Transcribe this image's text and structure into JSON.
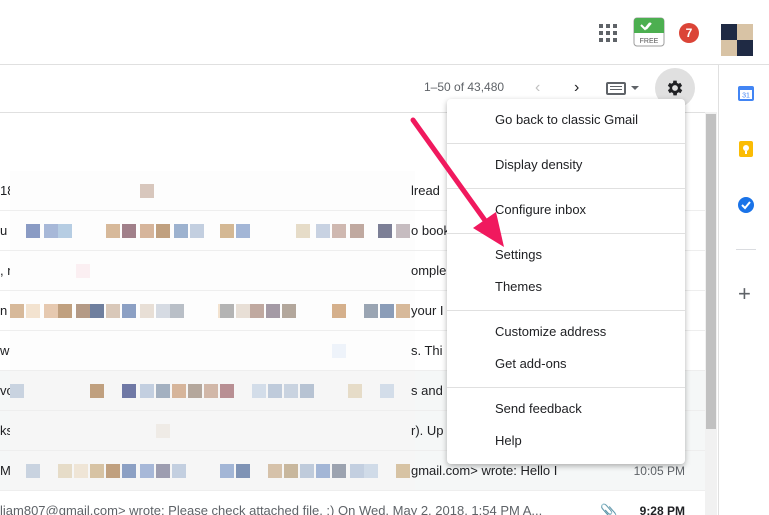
{
  "header": {
    "apps_icon": "apps-grid-icon",
    "free_badge_label": "FREE",
    "notification_count": "7"
  },
  "toolbar": {
    "pagination": "1–50 of 43,480",
    "prev_icon": "‹",
    "next_icon": "›"
  },
  "emails": [
    {
      "pre": "18",
      "mid": "lread"
    },
    {
      "pre": "u",
      "mid": "o book"
    },
    {
      "pre": ", n",
      "mid": "omple"
    },
    {
      "pre": "n a",
      "mid": "your I"
    },
    {
      "pre": "wo",
      "mid": "s. Thi"
    },
    {
      "pre": "vo",
      "mid": "s and"
    },
    {
      "pre": "ks",
      "mid": "r). Up"
    },
    {
      "pre": "Ma",
      "mid": "gmail.com> wrote: Hello I",
      "time": "10:05 PM"
    },
    {
      "pre": "liam807@gmail.com> wrote: Please check attached file. :) On Wed, May 2, 2018, 1:54 PM A...",
      "time": "9:28 PM"
    }
  ],
  "settings_menu": {
    "items": [
      "Go back to classic Gmail",
      "Display density",
      "Configure inbox",
      "Settings",
      "Themes",
      "Customize address",
      "Get add-ons",
      "Send feedback",
      "Help"
    ]
  },
  "side_panel": {
    "calendar_day": "31"
  },
  "colors": {
    "annotation_arrow": "#f0195e",
    "notification_badge": "#db4437",
    "gear_active_bg": "#e0e0e0"
  }
}
